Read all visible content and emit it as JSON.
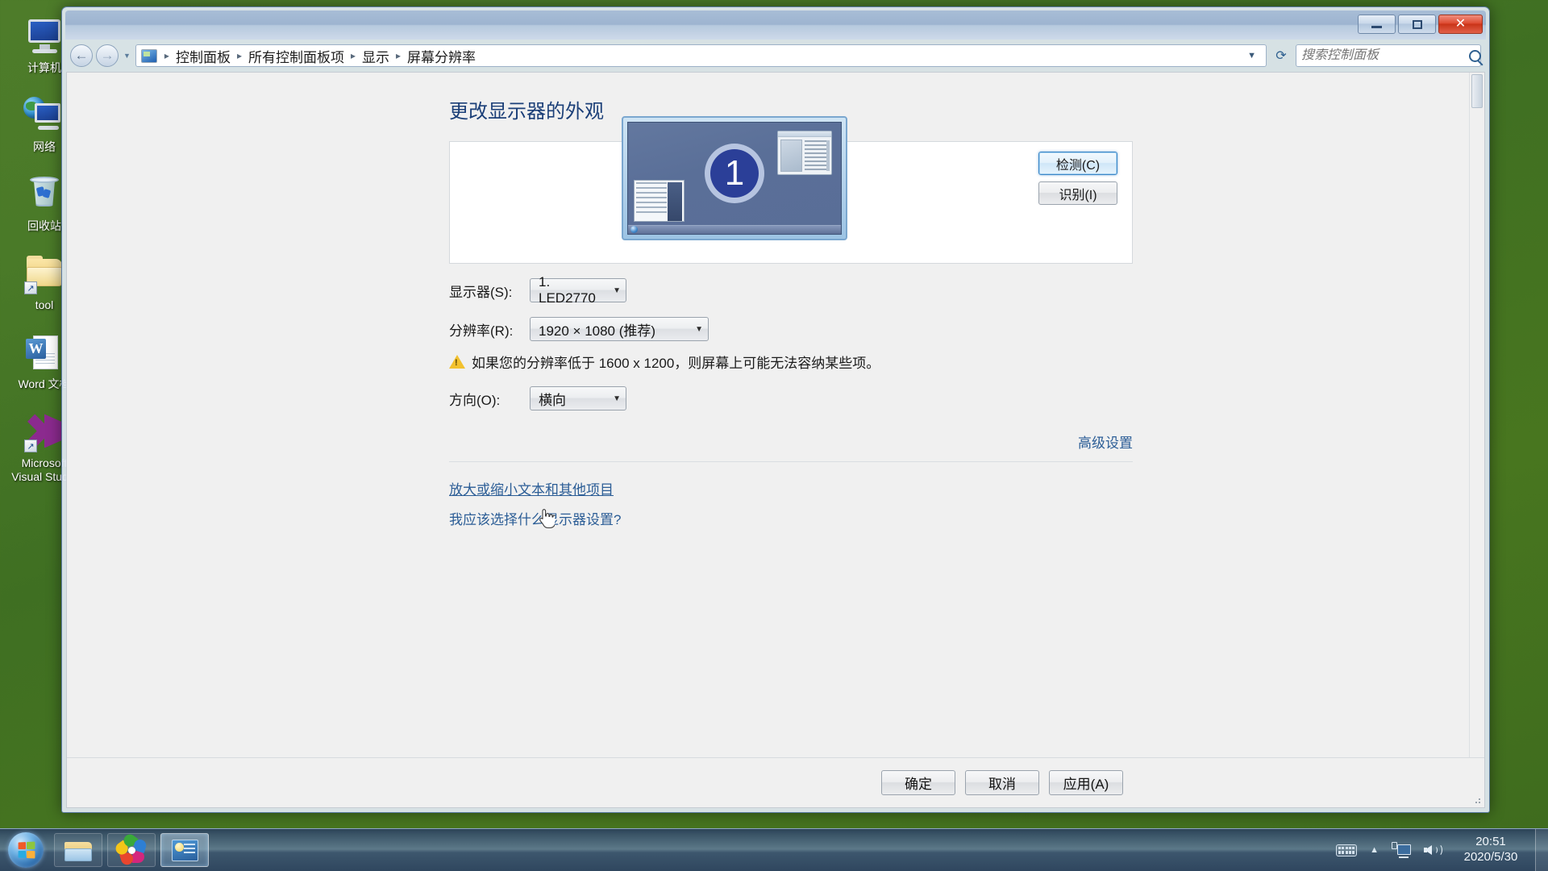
{
  "desktop": {
    "icons": [
      {
        "name": "computer",
        "label": "计算机",
        "kind": "computer-icon"
      },
      {
        "name": "network",
        "label": "网络",
        "kind": "network-icon"
      },
      {
        "name": "recycle-bin",
        "label": "回收站",
        "kind": "recycle-bin-icon"
      },
      {
        "name": "tool-folder",
        "label": "tool",
        "kind": "folder-shortcut-icon"
      },
      {
        "name": "word-doc",
        "label": "Word 文档",
        "kind": "word-document-icon"
      },
      {
        "name": "visual-studio",
        "label": "Microsoft\nVisual Studio",
        "kind": "visual-studio-icon"
      }
    ]
  },
  "window": {
    "controls": {
      "minimize": "最小化",
      "maximize": "最大化",
      "close": "关闭"
    },
    "nav": {
      "back": "后退",
      "forward": "前进",
      "recent_pages": "最近浏览的页面",
      "refresh": "刷新"
    },
    "breadcrumb": {
      "icon": "control-panel-icon",
      "items": [
        "控制面板",
        "所有控制面板项",
        "显示",
        "屏幕分辨率"
      ],
      "separator": "▸"
    },
    "search": {
      "placeholder": "搜索控制面板",
      "value": "",
      "icon": "search-icon"
    }
  },
  "main": {
    "title": "更改显示器的外观",
    "preview": {
      "monitor_number": "1",
      "detect_button": "检测(C)",
      "identify_button": "识别(I)"
    },
    "fields": {
      "monitor": {
        "label": "显示器(S):",
        "value": "1. LED2770"
      },
      "resolution": {
        "label": "分辨率(R):",
        "value": "1920 × 1080 (推荐)"
      },
      "orientation": {
        "label": "方向(O):",
        "value": "横向"
      }
    },
    "warning": {
      "icon": "warning-icon",
      "text": "如果您的分辨率低于 1600 x 1200，则屏幕上可能无法容纳某些项。"
    },
    "advanced_link": "高级设置",
    "links": [
      {
        "text": "放大或缩小文本和其他项目",
        "hovered": true
      },
      {
        "text": "我应该选择什么显示器设置?",
        "hovered": false
      }
    ],
    "buttons": {
      "ok": "确定",
      "cancel": "取消",
      "apply": "应用(A)"
    }
  },
  "taskbar": {
    "start": "开始",
    "items": [
      {
        "name": "windows-explorer",
        "label": "Windows 资源管理器",
        "active": false
      },
      {
        "name": "browser",
        "label": "浏览器",
        "active": false
      },
      {
        "name": "screen-resolution",
        "label": "屏幕分辨率",
        "active": true
      }
    ],
    "tray": [
      {
        "name": "ime-keyboard-icon",
        "label": "输入法"
      },
      {
        "name": "show-hidden-icons-icon",
        "label": "显示隐藏的图标"
      },
      {
        "name": "network-icon",
        "label": "网络"
      },
      {
        "name": "volume-icon",
        "label": "音量"
      }
    ],
    "clock": {
      "time": "20:51",
      "date": "2020/5/30"
    },
    "show_desktop": "显示桌面"
  },
  "colors": {
    "title_text": "#1b3f78",
    "link": "#2b5d96",
    "accent_focus": "#3c87c8",
    "warning": "#f2c12e",
    "desktop_bg": "#47751f"
  }
}
